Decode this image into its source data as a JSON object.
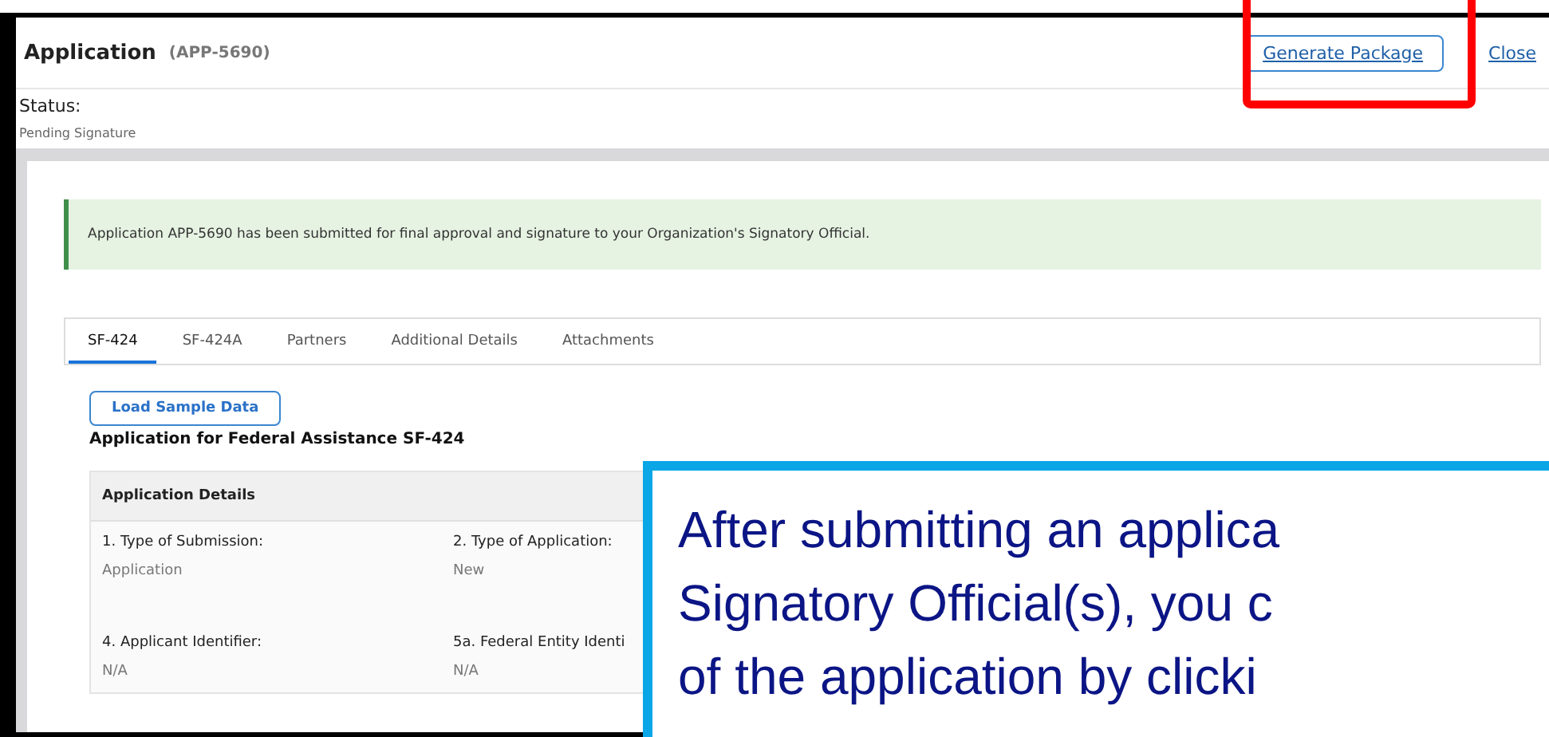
{
  "header": {
    "title": "Application",
    "id": "(APP-5690)",
    "buttons": [
      {
        "label": "Generate Package",
        "kind": "outlined"
      },
      {
        "label": "Close",
        "kind": "link"
      }
    ]
  },
  "status": {
    "label": "Status:",
    "value": "Pending Signature"
  },
  "alert": {
    "message": "Application APP-5690 has been submitted for final approval and signature to your Organization's Signatory Official."
  },
  "tabs": [
    {
      "label": "SF-424",
      "selected": true
    },
    {
      "label": "SF-424A",
      "selected": false
    },
    {
      "label": "Partners",
      "selected": false
    },
    {
      "label": "Additional Details",
      "selected": false
    },
    {
      "label": "Attachments",
      "selected": false
    }
  ],
  "load_button": "Load Sample Data",
  "form_title": "Application for Federal Assistance SF-424",
  "section": {
    "title": "Application Details",
    "fields": [
      {
        "label": "1. Type of Submission:",
        "value": "Application"
      },
      {
        "label": "2. Type of Application:",
        "value": "New"
      },
      {
        "label": "4. Applicant Identifier:",
        "value": "N/A"
      },
      {
        "label": "5a. Federal Entity Identi",
        "value": "N/A"
      }
    ]
  },
  "callout": {
    "lines": [
      "After submitting an applica",
      "Signatory Official(s), you c",
      "of the application by clicki"
    ]
  }
}
